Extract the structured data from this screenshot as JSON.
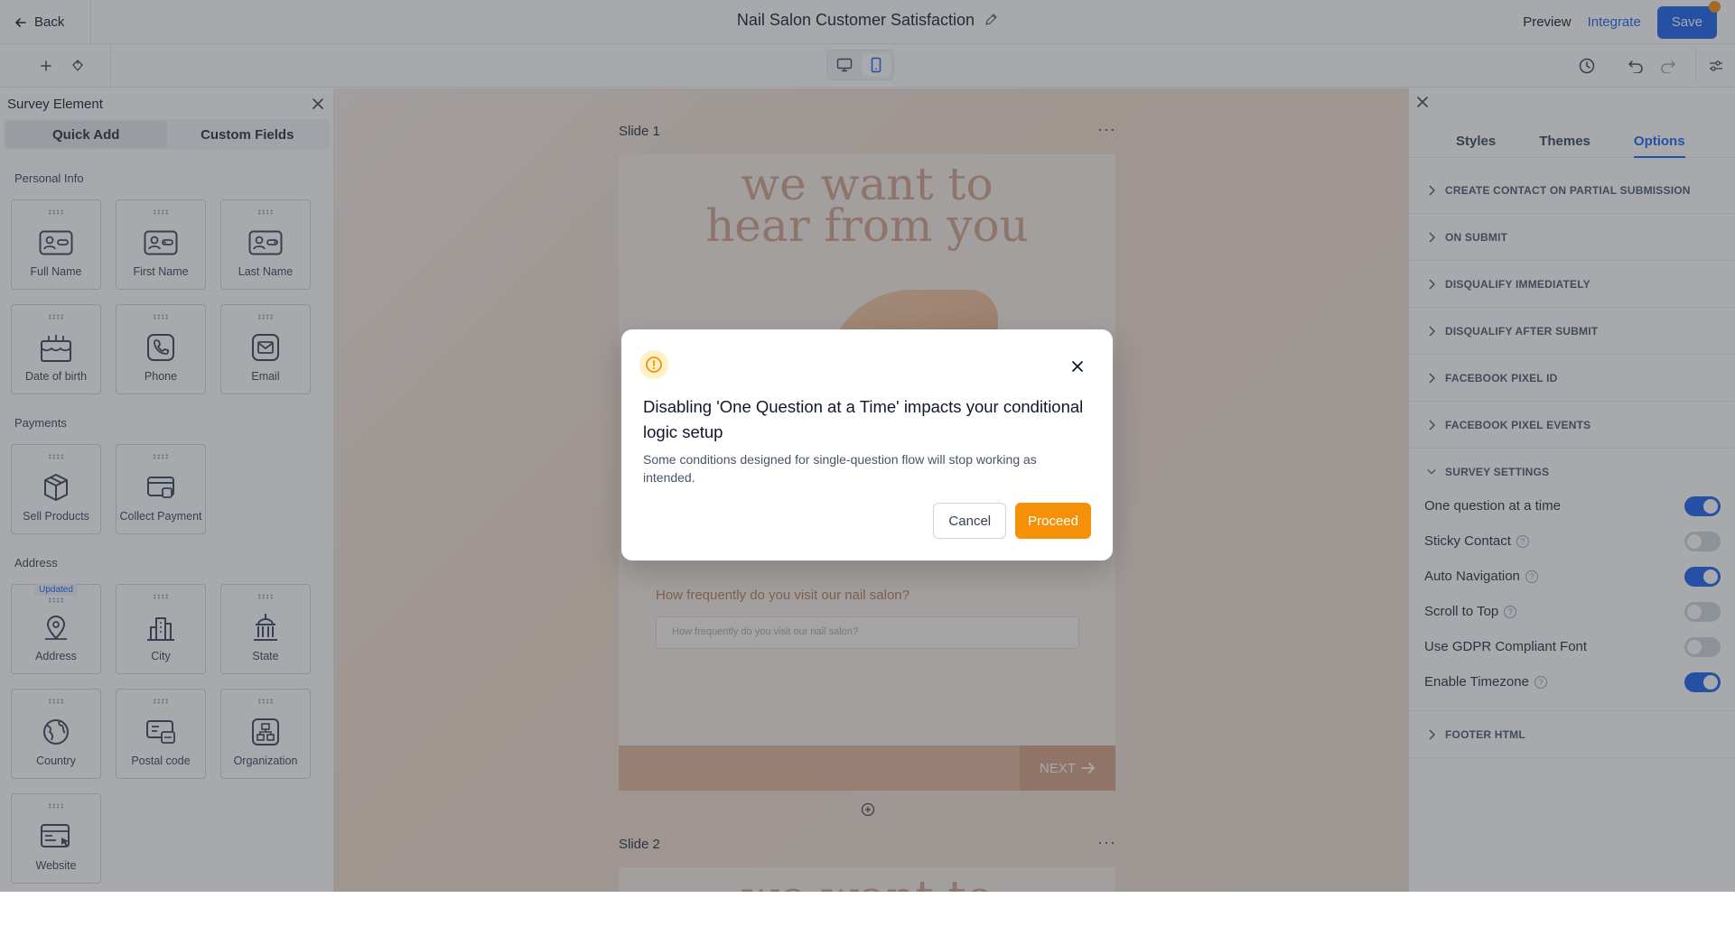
{
  "header": {
    "back_label": "Back",
    "title": "Nail Salon Customer Satisfaction",
    "preview_label": "Preview",
    "integrate_label": "Integrate",
    "save_label": "Save"
  },
  "left_panel": {
    "title": "Survey Element",
    "tabs": [
      {
        "label": "Quick Add",
        "active": true
      },
      {
        "label": "Custom Fields",
        "active": false
      }
    ],
    "sections": {
      "personal_info": {
        "title": "Personal Info",
        "items": [
          "Full Name",
          "First Name",
          "Last Name",
          "Date of birth",
          "Phone",
          "Email"
        ]
      },
      "payments": {
        "title": "Payments",
        "items": [
          "Sell Products",
          "Collect Payment"
        ]
      },
      "address": {
        "title": "Address",
        "badge": "Updated",
        "items": [
          "Address",
          "City",
          "State",
          "Country",
          "Postal code",
          "Organization",
          "Website"
        ]
      }
    }
  },
  "canvas": {
    "slide1_label": "Slide 1",
    "slide2_label": "Slide 2",
    "hero_line1": "we want to",
    "hero_line2": "hear from you",
    "slide2_hero_line1": "we want to",
    "question_label": "How frequently do you visit our nail salon?",
    "question_placeholder": "How frequently do you visit our nail salon?",
    "next_label": "NEXT",
    "menu_glyph": "···"
  },
  "right_panel": {
    "tabs": [
      {
        "label": "Styles",
        "active": false
      },
      {
        "label": "Themes",
        "active": false
      },
      {
        "label": "Options",
        "active": true
      }
    ],
    "accordions": [
      "CREATE CONTACT ON PARTIAL SUBMISSION",
      "ON SUBMIT",
      "DISQUALIFY IMMEDIATELY",
      "DISQUALIFY AFTER SUBMIT",
      "FACEBOOK PIXEL ID",
      "FACEBOOK PIXEL EVENTS"
    ],
    "survey_settings": {
      "title": "SURVEY SETTINGS",
      "rows": [
        {
          "label": "One question at a time",
          "help": false,
          "on": true
        },
        {
          "label": "Sticky Contact",
          "help": true,
          "on": false
        },
        {
          "label": "Auto Navigation",
          "help": true,
          "on": true
        },
        {
          "label": "Scroll to Top",
          "help": true,
          "on": false
        },
        {
          "label": "Use GDPR Compliant Font",
          "help": false,
          "on": false
        },
        {
          "label": "Enable Timezone",
          "help": true,
          "on": true
        }
      ]
    },
    "footer_accordion": "FOOTER HTML"
  },
  "modal": {
    "title": "Disabling 'One Question at a Time' impacts your conditional logic setup",
    "body": "Some conditions designed for single-question flow will stop working as intended.",
    "cancel_label": "Cancel",
    "proceed_label": "Proceed"
  },
  "colors": {
    "primary": "#155eef",
    "warning": "#f79009"
  }
}
